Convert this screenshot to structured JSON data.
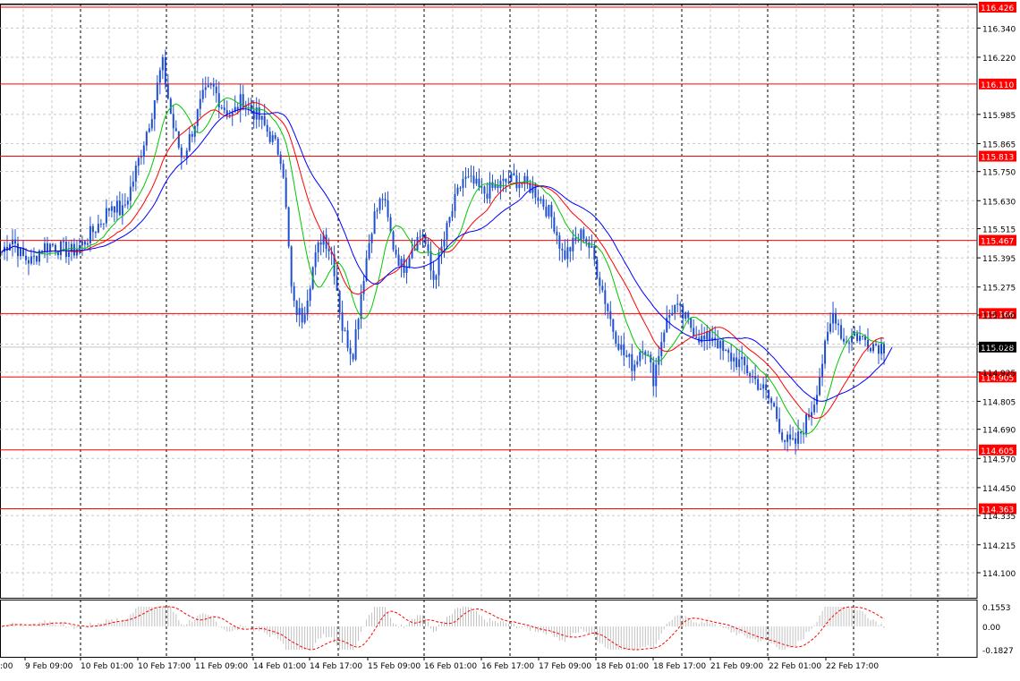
{
  "chart_data": [
    {
      "type": "candlestick",
      "title": "",
      "ylim": [
        114.1,
        116.426
      ],
      "y_ticks": [
        "116.340",
        "116.220",
        "115.985",
        "115.865",
        "115.750",
        "115.630",
        "115.515",
        "115.395",
        "115.275",
        "115.160",
        "115.040",
        "114.925",
        "114.805",
        "114.690",
        "114.570",
        "114.450",
        "114.335",
        "114.215",
        "114.100"
      ],
      "x_ticks": [
        "9 Feb 09:00",
        "10 Feb 01:00",
        "10 Feb 17:00",
        "11 Feb 09:00",
        "14 Feb 01:00",
        "14 Feb 17:00",
        "15 Feb 09:00",
        "16 Feb 01:00",
        "16 Feb 17:00",
        "17 Feb 09:00",
        "18 Feb 01:00",
        "18 Feb 17:00",
        "21 Feb 09:00",
        "22 Feb 01:00",
        "22 Feb 17:00"
      ],
      "x_tick_first_partial": ":00",
      "current_price": {
        "value": 115.028,
        "label": "115.028",
        "color": "#000000"
      },
      "horizontal_levels": [
        {
          "value": 116.426,
          "label": "116.426"
        },
        {
          "value": 116.11,
          "label": "116.110"
        },
        {
          "value": 115.813,
          "label": "115.813"
        },
        {
          "value": 115.467,
          "label": "115.467"
        },
        {
          "value": 115.166,
          "label": "115.166"
        },
        {
          "value": 114.905,
          "label": "114.905"
        },
        {
          "value": 114.605,
          "label": "114.605"
        },
        {
          "value": 114.363,
          "label": "114.363"
        }
      ],
      "level_color": "#ff0000",
      "price_series": [
        115.42,
        115.48,
        115.4,
        115.38,
        115.44,
        115.45,
        115.43,
        115.42,
        115.45,
        115.5,
        115.55,
        115.62,
        115.58,
        115.7,
        115.85,
        116.0,
        116.2,
        115.95,
        115.8,
        115.92,
        116.05,
        116.1,
        116.02,
        115.98,
        116.05,
        116.0,
        115.95,
        115.88,
        115.8,
        115.2,
        115.15,
        115.35,
        115.5,
        115.4,
        115.1,
        115.0,
        115.3,
        115.55,
        115.65,
        115.45,
        115.35,
        115.45,
        115.5,
        115.3,
        115.45,
        115.6,
        115.72,
        115.7,
        115.66,
        115.68,
        115.7,
        115.72,
        115.7,
        115.68,
        115.62,
        115.55,
        115.4,
        115.45,
        115.5,
        115.4,
        115.25,
        115.1,
        115.0,
        114.95,
        115.05,
        114.9,
        115.1,
        115.2,
        115.15,
        115.1,
        115.05,
        115.08,
        115.0,
        114.98,
        114.95,
        114.9,
        114.85,
        114.78,
        114.65,
        114.62,
        114.7,
        114.8,
        115.0,
        115.18,
        115.05,
        115.08,
        115.06,
        115.04,
        115.03
      ],
      "ma_fast": {
        "color": "#00c800"
      },
      "ma_mid": {
        "color": "#ff0000"
      },
      "ma_slow": {
        "color": "#0000ff"
      },
      "candle_color": "#1f4fd1"
    },
    {
      "type": "oscillator",
      "ylim": [
        -0.1827,
        0.1553
      ],
      "y_ticks": [
        "0.1553",
        "0.00",
        "-0.1827"
      ],
      "signal_color": "#ff0000",
      "histogram_color": "#c0c0c0"
    }
  ]
}
